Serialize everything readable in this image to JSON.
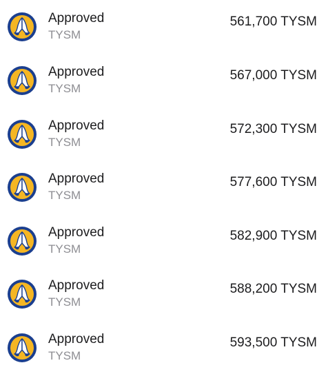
{
  "transactions": [
    {
      "status": "Approved",
      "symbol": "TYSM",
      "amount": "561,700 TYSM",
      "icon": "tysm-token-icon"
    },
    {
      "status": "Approved",
      "symbol": "TYSM",
      "amount": "567,000 TYSM",
      "icon": "tysm-token-icon"
    },
    {
      "status": "Approved",
      "symbol": "TYSM",
      "amount": "572,300 TYSM",
      "icon": "tysm-token-icon"
    },
    {
      "status": "Approved",
      "symbol": "TYSM",
      "amount": "577,600 TYSM",
      "icon": "tysm-token-icon"
    },
    {
      "status": "Approved",
      "symbol": "TYSM",
      "amount": "582,900 TYSM",
      "icon": "tysm-token-icon"
    },
    {
      "status": "Approved",
      "symbol": "TYSM",
      "amount": "588,200 TYSM",
      "icon": "tysm-token-icon"
    },
    {
      "status": "Approved",
      "symbol": "TYSM",
      "amount": "593,500 TYSM",
      "icon": "tysm-token-icon"
    }
  ],
  "colors": {
    "icon_ring": "#1b3f8f",
    "icon_fill": "#f5b623",
    "icon_hands": "#1b3f8f",
    "status_text": "#1c1c1e",
    "symbol_text": "#8e8e93"
  }
}
